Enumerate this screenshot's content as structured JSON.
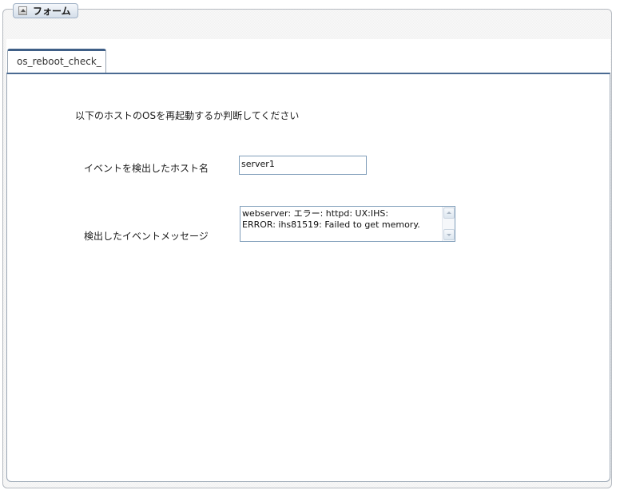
{
  "form": {
    "legend_label": "フォーム",
    "tab_label": "os_reboot_check_",
    "instruction": "以下のホストのOSを再起動するか判断してください",
    "host_label": "イベントを検出したホスト名",
    "host_value": "server1",
    "message_label": "検出したイベントメッセージ",
    "message_value": "webserver: エラー: httpd: UX:IHS:\nERROR: ihs81519: Failed to get memory."
  },
  "icons": {
    "legend_icon": "collapse-icon",
    "scroll_up": "scroll-up-icon",
    "scroll_down": "scroll-down-icon"
  }
}
